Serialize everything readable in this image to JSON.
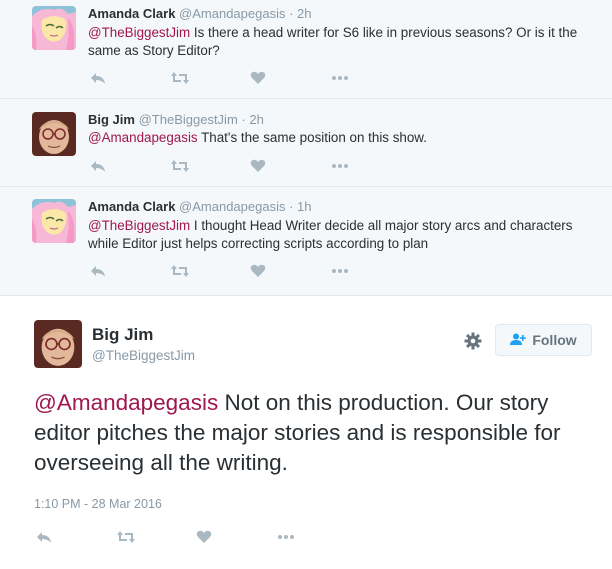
{
  "replies": [
    {
      "name": "Amanda Clark",
      "handle": "@Amandapegasis",
      "time": "· 2h",
      "mention": "@TheBiggestJim",
      "text": " Is there a head writer for S6 like in previous seasons? Or is it the same as Story Editor?",
      "avatar_icon": "pony-avatar"
    },
    {
      "name": "Big Jim",
      "handle": "@TheBiggestJim",
      "time": "· 2h",
      "mention": "@Amandapegasis",
      "text": " That's the same position on this show.",
      "avatar_icon": "cartoon-man-avatar"
    },
    {
      "name": "Amanda Clark",
      "handle": "@Amandapegasis",
      "time": "· 1h",
      "mention": "@TheBiggestJim",
      "text": " I thought Head Writer decide all major story arcs and characters while Editor just helps correcting scripts according to plan",
      "avatar_icon": "pony-avatar"
    }
  ],
  "main": {
    "name": "Big Jim",
    "handle": "@TheBiggestJim",
    "follow_label": "Follow",
    "mention": "@Amandapegasis",
    "text": " Not on this production. Our story editor pitches the major stories and is responsible for overseeing all the writing.",
    "timestamp": "1:10 PM - 28 Mar 2016"
  },
  "icons": [
    "reply-icon",
    "retweet-icon",
    "like-icon",
    "more-icon",
    "gear-icon",
    "follow-user-icon"
  ],
  "colors": {
    "mention": "#a0174f",
    "muted": "#8899a6",
    "action_icon": "#aab8c2",
    "thread_bg": "#f5f8fa"
  }
}
